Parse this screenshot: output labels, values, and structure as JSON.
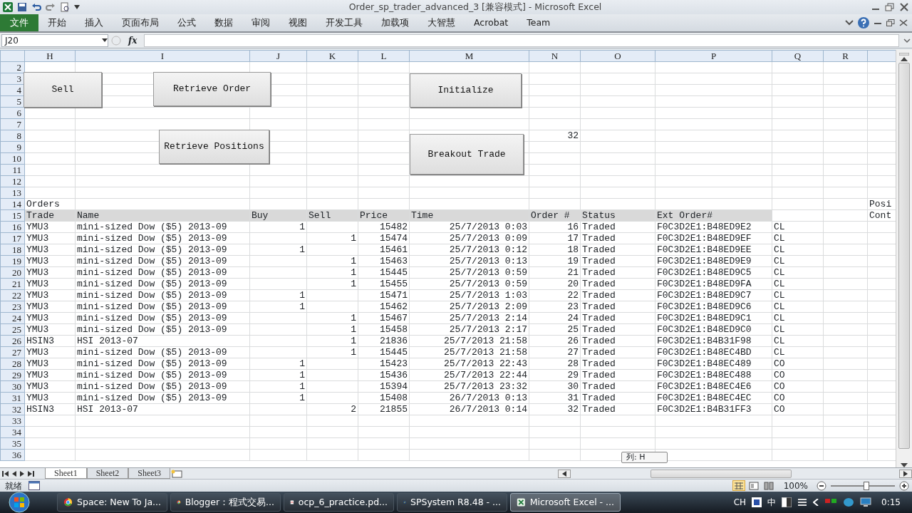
{
  "window": {
    "title": "Order_sp_trader_advanced_3  [兼容模式] - Microsoft Excel"
  },
  "ribbon": {
    "tabs": [
      {
        "label": "文件",
        "kind": "file"
      },
      {
        "label": "开始",
        "kind": "tab"
      },
      {
        "label": "插入",
        "kind": "tab"
      },
      {
        "label": "页面布局",
        "kind": "tab"
      },
      {
        "label": "公式",
        "kind": "tab"
      },
      {
        "label": "数据",
        "kind": "tab"
      },
      {
        "label": "审阅",
        "kind": "tab"
      },
      {
        "label": "视图",
        "kind": "tab"
      },
      {
        "label": "开发工具",
        "kind": "tab"
      },
      {
        "label": "加载项",
        "kind": "tab"
      },
      {
        "label": "大智慧",
        "kind": "tab"
      },
      {
        "label": "Acrobat",
        "kind": "tab"
      },
      {
        "label": "Team",
        "kind": "tab"
      }
    ]
  },
  "formula_bar": {
    "name_box": "J20",
    "function_label": "fx"
  },
  "sheet": {
    "columns": [
      "H",
      "I",
      "J",
      "K",
      "L",
      "M",
      "N",
      "O",
      "P",
      "Q",
      "R"
    ],
    "buttons": [
      {
        "label": "Sell"
      },
      {
        "label": "Retrieve Order"
      },
      {
        "label": "Initialize"
      },
      {
        "label": "Retrieve Positions"
      },
      {
        "label": "Breakout Trade"
      }
    ],
    "tooltip": "列: H",
    "rows": [
      {
        "number": "2"
      },
      {
        "number": "3"
      },
      {
        "number": "4"
      },
      {
        "number": "5"
      },
      {
        "number": "6"
      },
      {
        "number": "7"
      },
      {
        "number": "8",
        "cells": {
          "N": "32"
        }
      },
      {
        "number": "9"
      },
      {
        "number": "10"
      },
      {
        "number": "11"
      },
      {
        "number": "12"
      },
      {
        "number": "13"
      },
      {
        "number": "14",
        "cells": {
          "H": "Orders",
          "edge": "Posi"
        }
      },
      {
        "number": "15",
        "kind": "header",
        "cells": {
          "H": "Trade",
          "I": "Name",
          "J": "Buy",
          "K": "Sell",
          "L": "Price",
          "M": "Time",
          "N": "Order #",
          "O": "Status",
          "P": "Ext Order#",
          "edge": "Cont"
        }
      },
      {
        "number": "16",
        "cells": {
          "H": "YMU3",
          "I": "mini-sized Dow ($5) 2013-09",
          "J": "1",
          "L": "15482",
          "M": "25/7/2013 0:03",
          "N": "16",
          "O": "Traded",
          "P": "F0C3D2E1:B48ED9E2",
          "Q": "CL"
        }
      },
      {
        "number": "17",
        "cells": {
          "H": "YMU3",
          "I": "mini-sized Dow ($5) 2013-09",
          "K": "1",
          "L": "15474",
          "M": "25/7/2013 0:09",
          "N": "17",
          "O": "Traded",
          "P": "F0C3D2E1:B48ED9EF",
          "Q": "CL"
        }
      },
      {
        "number": "18",
        "cells": {
          "H": "YMU3",
          "I": "mini-sized Dow ($5) 2013-09",
          "J": "1",
          "L": "15461",
          "M": "25/7/2013 0:12",
          "N": "18",
          "O": "Traded",
          "P": "F0C3D2E1:B48ED9EE",
          "Q": "CL"
        }
      },
      {
        "number": "19",
        "cells": {
          "H": "YMU3",
          "I": "mini-sized Dow ($5) 2013-09",
          "K": "1",
          "L": "15463",
          "M": "25/7/2013 0:13",
          "N": "19",
          "O": "Traded",
          "P": "F0C3D2E1:B48ED9E9",
          "Q": "CL"
        }
      },
      {
        "number": "20",
        "cells": {
          "H": "YMU3",
          "I": "mini-sized Dow ($5) 2013-09",
          "K": "1",
          "L": "15445",
          "M": "25/7/2013 0:59",
          "N": "21",
          "O": "Traded",
          "P": "F0C3D2E1:B48ED9C5",
          "Q": "CL"
        }
      },
      {
        "number": "21",
        "cells": {
          "H": "YMU3",
          "I": "mini-sized Dow ($5) 2013-09",
          "K": "1",
          "L": "15455",
          "M": "25/7/2013 0:59",
          "N": "20",
          "O": "Traded",
          "P": "F0C3D2E1:B48ED9FA",
          "Q": "CL"
        }
      },
      {
        "number": "22",
        "cells": {
          "H": "YMU3",
          "I": "mini-sized Dow ($5) 2013-09",
          "J": "1",
          "L": "15471",
          "M": "25/7/2013 1:03",
          "N": "22",
          "O": "Traded",
          "P": "F0C3D2E1:B48ED9C7",
          "Q": "CL"
        }
      },
      {
        "number": "23",
        "cells": {
          "H": "YMU3",
          "I": "mini-sized Dow ($5) 2013-09",
          "J": "1",
          "L": "15462",
          "M": "25/7/2013 2:09",
          "N": "23",
          "O": "Traded",
          "P": "F0C3D2E1:B48ED9C6",
          "Q": "CL"
        }
      },
      {
        "number": "24",
        "cells": {
          "H": "YMU3",
          "I": "mini-sized Dow ($5) 2013-09",
          "K": "1",
          "L": "15467",
          "M": "25/7/2013 2:14",
          "N": "24",
          "O": "Traded",
          "P": "F0C3D2E1:B48ED9C1",
          "Q": "CL"
        }
      },
      {
        "number": "25",
        "cells": {
          "H": "YMU3",
          "I": "mini-sized Dow ($5) 2013-09",
          "K": "1",
          "L": "15458",
          "M": "25/7/2013 2:17",
          "N": "25",
          "O": "Traded",
          "P": "F0C3D2E1:B48ED9C0",
          "Q": "CL"
        }
      },
      {
        "number": "26",
        "cells": {
          "H": "HSIN3",
          "I": "HSI 2013-07",
          "K": "1",
          "L": "21836",
          "M": "25/7/2013 21:58",
          "N": "26",
          "O": "Traded",
          "P": "F0C3D2E1:B4B31F98",
          "Q": "CL"
        }
      },
      {
        "number": "27",
        "cells": {
          "H": "YMU3",
          "I": "mini-sized Dow ($5) 2013-09",
          "K": "1",
          "L": "15445",
          "M": "25/7/2013 21:58",
          "N": "27",
          "O": "Traded",
          "P": "F0C3D2E1:B48EC4BD",
          "Q": "CL"
        }
      },
      {
        "number": "28",
        "cells": {
          "H": "YMU3",
          "I": "mini-sized Dow ($5) 2013-09",
          "J": "1",
          "L": "15423",
          "M": "25/7/2013 22:43",
          "N": "28",
          "O": "Traded",
          "P": "F0C3D2E1:B48EC489",
          "Q": "CO"
        }
      },
      {
        "number": "29",
        "cells": {
          "H": "YMU3",
          "I": "mini-sized Dow ($5) 2013-09",
          "J": "1",
          "L": "15436",
          "M": "25/7/2013 22:44",
          "N": "29",
          "O": "Traded",
          "P": "F0C3D2E1:B48EC488",
          "Q": "CO"
        }
      },
      {
        "number": "30",
        "cells": {
          "H": "YMU3",
          "I": "mini-sized Dow ($5) 2013-09",
          "J": "1",
          "L": "15394",
          "M": "25/7/2013 23:32",
          "N": "30",
          "O": "Traded",
          "P": "F0C3D2E1:B48EC4E6",
          "Q": "CO"
        }
      },
      {
        "number": "31",
        "cells": {
          "H": "YMU3",
          "I": "mini-sized Dow ($5) 2013-09",
          "J": "1",
          "L": "15408",
          "M": "26/7/2013 0:13",
          "N": "31",
          "O": "Traded",
          "P": "F0C3D2E1:B48EC4EC",
          "Q": "CO"
        }
      },
      {
        "number": "32",
        "cells": {
          "H": "HSIN3",
          "I": "HSI 2013-07",
          "K": "2",
          "L": "21855",
          "M": "26/7/2013 0:14",
          "N": "32",
          "O": "Traded",
          "P": "F0C3D2E1:B4B31FF3",
          "Q": "CO"
        }
      },
      {
        "number": "33"
      },
      {
        "number": "34"
      },
      {
        "number": "35"
      },
      {
        "number": "36"
      }
    ]
  },
  "sheet_tabs": [
    {
      "label": "Sheet1",
      "selected": true
    },
    {
      "label": "Sheet2",
      "selected": false
    },
    {
      "label": "Sheet3",
      "selected": false
    }
  ],
  "status_bar": {
    "status": "就绪",
    "views": [
      {
        "kind": "normal",
        "selected": true
      },
      {
        "kind": "layout",
        "selected": false
      },
      {
        "kind": "break",
        "selected": false
      }
    ],
    "zoom": "100%",
    "zoom_slider": {
      "level": 0.55
    }
  },
  "taskbar": {
    "items": [
      {
        "label": "Space: New To Ja...",
        "kind": "browser",
        "selected": false
      },
      {
        "label": "Blogger：程式交易...",
        "kind": "browser",
        "selected": false
      },
      {
        "label": "ocp_6_practice.pd...",
        "kind": "pdf",
        "selected": false
      },
      {
        "label": "SPSystem R8.48 - ...",
        "kind": "sp",
        "selected": false
      },
      {
        "label": "Microsoft Excel - ...",
        "kind": "excel",
        "selected": true
      }
    ],
    "tray": {
      "language": "CH",
      "ime": "中",
      "clock": "0:15"
    }
  }
}
